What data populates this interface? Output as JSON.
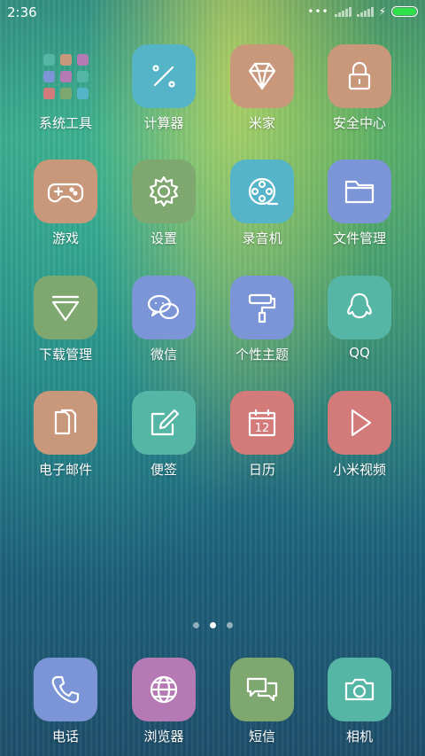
{
  "status_bar": {
    "time": "2:36",
    "battery_color": "#2fe04a"
  },
  "apps": [
    {
      "name": "folder-system-tools",
      "label": "系统工具",
      "icon": "folder-icon",
      "color": ""
    },
    {
      "name": "calculator",
      "label": "计算器",
      "icon": "calculator-icon",
      "color": "#56b4c8"
    },
    {
      "name": "mijia",
      "label": "米家",
      "icon": "diamond-icon",
      "color": "#c9977a"
    },
    {
      "name": "security-center",
      "label": "安全中心",
      "icon": "lock-icon",
      "color": "#c9977a"
    },
    {
      "name": "games",
      "label": "游戏",
      "icon": "gamepad-icon",
      "color": "#c9977a"
    },
    {
      "name": "settings",
      "label": "设置",
      "icon": "gear-icon",
      "color": "#7fa870"
    },
    {
      "name": "recorder",
      "label": "录音机",
      "icon": "film-reel-icon",
      "color": "#56b4c8"
    },
    {
      "name": "file-manager",
      "label": "文件管理",
      "icon": "folder-outline-icon",
      "color": "#7c95d6"
    },
    {
      "name": "download-manager",
      "label": "下载管理",
      "icon": "download-triangle-icon",
      "color": "#7fa870"
    },
    {
      "name": "wechat",
      "label": "微信",
      "icon": "chat-bubbles-icon",
      "color": "#7c95d6"
    },
    {
      "name": "themes",
      "label": "个性主题",
      "icon": "paint-roller-icon",
      "color": "#7c95d6"
    },
    {
      "name": "qq",
      "label": "QQ",
      "icon": "penguin-icon",
      "color": "#55b6a5"
    },
    {
      "name": "email",
      "label": "电子邮件",
      "icon": "documents-icon",
      "color": "#c9977a"
    },
    {
      "name": "notes",
      "label": "便签",
      "icon": "note-pen-icon",
      "color": "#55b6a5"
    },
    {
      "name": "calendar",
      "label": "日历",
      "icon": "calendar-icon",
      "color": "#d27b7a",
      "calendar_day": "12"
    },
    {
      "name": "mi-video",
      "label": "小米视频",
      "icon": "play-icon",
      "color": "#d27b7a"
    }
  ],
  "dock": [
    {
      "name": "phone",
      "label": "电话",
      "icon": "phone-icon",
      "color": "#7c95d6"
    },
    {
      "name": "browser",
      "label": "浏览器",
      "icon": "globe-icon",
      "color": "#b57ab4"
    },
    {
      "name": "messages",
      "label": "短信",
      "icon": "message-bubbles-icon",
      "color": "#7fa870"
    },
    {
      "name": "camera",
      "label": "相机",
      "icon": "camera-icon",
      "color": "#55b6a5"
    }
  ],
  "page_indicator": {
    "pages": 3,
    "active": 2
  },
  "folder_mini_colors": [
    "#55b6a5",
    "#c9977a",
    "#b57ab4",
    "#7c95d6",
    "#b57ab4",
    "#55b6a5",
    "#d27b7a",
    "#7fa870",
    "#56b4c8"
  ]
}
